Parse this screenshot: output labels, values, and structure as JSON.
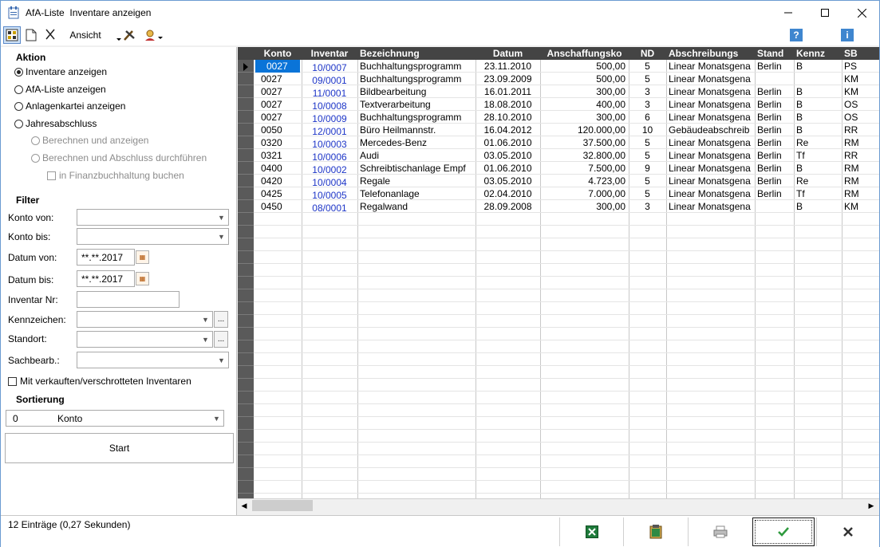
{
  "window": {
    "app_name": "AfA-Liste",
    "title": "Inventare anzeigen",
    "controls": [
      "—",
      "☐",
      "✕"
    ]
  },
  "toolbar": {
    "view_menu": "Ansicht",
    "help_glyph": "?",
    "info_glyph": "i"
  },
  "aktion": {
    "heading": "Aktion",
    "options": [
      {
        "label": "Inventare anzeigen",
        "checked": true,
        "enabled": true
      },
      {
        "label": "AfA-Liste anzeigen",
        "checked": false,
        "enabled": true
      },
      {
        "label": "Anlagenkartei anzeigen",
        "checked": false,
        "enabled": true
      },
      {
        "label": "Jahresabschluss",
        "checked": false,
        "enabled": true
      },
      {
        "label": "Berechnen und anzeigen",
        "checked": false,
        "enabled": false
      },
      {
        "label": "Berechnen und Abschluss durchführen",
        "checked": false,
        "enabled": false
      }
    ],
    "fibu_checkbox": "in Finanzbuchhaltung buchen"
  },
  "filter": {
    "heading": "Filter",
    "konto_von": "Konto von:",
    "konto_bis": "Konto bis:",
    "datum_von": "Datum von:",
    "datum_von_value": "**.**.2017",
    "datum_bis": "Datum bis:",
    "datum_bis_value": "**.**.2017",
    "inventar_nr": "Inventar Nr:",
    "kennzeichen": "Kennzeichen:",
    "standort": "Standort:",
    "sachbearb": "Sachbearb.:",
    "verkauft_checkbox": "Mit verkauften/verschrotteten Inventaren",
    "dots": "..."
  },
  "sortierung": {
    "heading": "Sortierung",
    "value_code": "0",
    "value_label": "Konto"
  },
  "start_button": "Start",
  "grid": {
    "columns": [
      "Konto",
      "Inventar",
      "Bezeichnung",
      "Datum",
      "Anschaffungsko",
      "ND",
      "Abschreibungs",
      "Stand",
      "Kennz",
      "SB"
    ],
    "rows": [
      [
        "0027",
        "10/0007",
        "Buchhaltungsprogramm",
        "23.11.2010",
        "500,00",
        "5",
        "Linear Monatsgena",
        "Berlin",
        "B",
        "PS"
      ],
      [
        "0027",
        "09/0001",
        "Buchhaltungsprogramm",
        "23.09.2009",
        "500,00",
        "5",
        "Linear Monatsgena",
        "",
        "",
        "KM"
      ],
      [
        "0027",
        "11/0001",
        "Bildbearbeitung",
        "16.01.2011",
        "300,00",
        "3",
        "Linear Monatsgena",
        "Berlin",
        "B",
        "KM"
      ],
      [
        "0027",
        "10/0008",
        "Textverarbeitung",
        "18.08.2010",
        "400,00",
        "3",
        "Linear Monatsgena",
        "Berlin",
        "B",
        "OS"
      ],
      [
        "0027",
        "10/0009",
        "Buchhaltungsprogramm",
        "28.10.2010",
        "300,00",
        "6",
        "Linear Monatsgena",
        "Berlin",
        "B",
        "OS"
      ],
      [
        "0050",
        "12/0001",
        "Büro Heilmannstr.",
        "16.04.2012",
        "120.000,00",
        "10",
        "Gebäudeabschreib",
        "Berlin",
        "B",
        "RR"
      ],
      [
        "0320",
        "10/0003",
        "Mercedes-Benz",
        "01.06.2010",
        "37.500,00",
        "5",
        "Linear Monatsgena",
        "Berlin",
        "Re",
        "RM"
      ],
      [
        "0321",
        "10/0006",
        "Audi",
        "03.05.2010",
        "32.800,00",
        "5",
        "Linear Monatsgena",
        "Berlin",
        "Tf",
        "RR"
      ],
      [
        "0400",
        "10/0002",
        "Schreibtischanlage Empf",
        "01.06.2010",
        "7.500,00",
        "9",
        "Linear Monatsgena",
        "Berlin",
        "B",
        "RM"
      ],
      [
        "0420",
        "10/0004",
        "Regale",
        "03.05.2010",
        "4.723,00",
        "5",
        "Linear Monatsgena",
        "Berlin",
        "Re",
        "RM"
      ],
      [
        "0425",
        "10/0005",
        "Telefonanlage",
        "02.04.2010",
        "7.000,00",
        "5",
        "Linear Monatsgena",
        "Berlin",
        "Tf",
        "RM"
      ],
      [
        "0450",
        "08/0001",
        "Regalwand",
        "28.09.2008",
        "300,00",
        "3",
        "Linear Monatsgena",
        "",
        "B",
        "KM"
      ]
    ]
  },
  "status": {
    "text": "12 Einträge (0,27 Sekunden)"
  },
  "colors": {
    "header_bg": "#444444",
    "selection_blue": "#0a74d8",
    "link_blue": "#1d35c7",
    "ok_green": "#2e9a3e"
  }
}
